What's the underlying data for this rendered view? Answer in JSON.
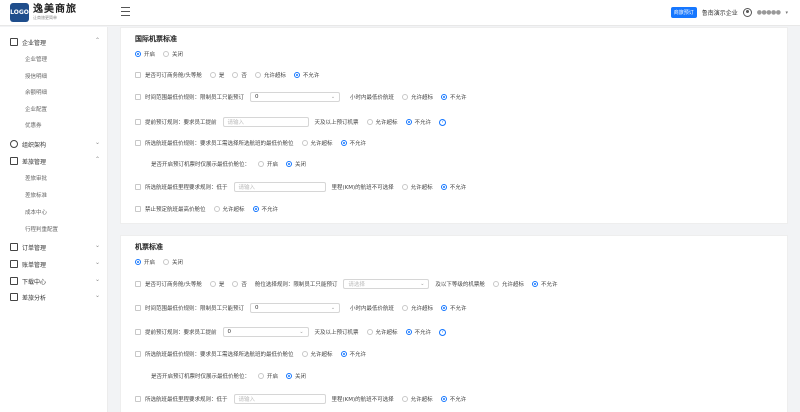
{
  "header": {
    "logo_mark": "LOGO",
    "logo_title": "逸美商旅",
    "logo_sub": "让商旅更简单",
    "badge": "商旅预订",
    "company": "鲁南演示企业",
    "username": "●●●●●"
  },
  "sidebar": {
    "groups": [
      {
        "label": "企业管理",
        "icon": "building-icon"
      },
      {
        "label": "组织架构",
        "icon": "org-icon"
      },
      {
        "label": "差旅管理",
        "icon": "briefcase-icon"
      },
      {
        "label": "订单管理",
        "icon": "order-icon"
      },
      {
        "label": "账单管理",
        "icon": "bill-icon"
      },
      {
        "label": "下载中心",
        "icon": "download-icon"
      },
      {
        "label": "差旅分析",
        "icon": "chart-icon"
      }
    ],
    "sub_enterprise": [
      "企业管理",
      "授信明细",
      "余额明细",
      "企业配置",
      "优惠券"
    ],
    "sub_travel": [
      "差旅审批",
      "差旅标准",
      "成本中心",
      "行程判重配置"
    ]
  },
  "card1": {
    "title": "国际机票标准",
    "enable": "开启",
    "disable": "关闭",
    "r1": "是否可订商务舱/头等舱",
    "yes": "是",
    "no": "否",
    "allow_over": "允许超标",
    "disallow": "不允许",
    "r2": "时间范围最低价规则：限制员工只能预订",
    "r2_value": "0",
    "r2_suffix": "小时内最低价航班",
    "r3": "提前预订规则：要求员工提前",
    "r3_placeholder": "请输入",
    "r3_suffix": "天及以上预订机票",
    "r4": "所选航班最低价规则：要求员工需选择所选航班的最低价舱位",
    "r5": "是否开启预订机票时仅展示最低价舱位：",
    "open": "开启",
    "close": "关闭",
    "r6": "所选航班最低里程要求规则：低于",
    "r6_placeholder": "请输入",
    "r6_suffix": "里程(KM)的航班不可选择",
    "r7": "禁止预定航班最高价舱位"
  },
  "card2": {
    "title": "机票标准",
    "enable": "开启",
    "disable": "关闭",
    "r1": "是否可订商务舱/头等舱",
    "yes": "是",
    "no": "否",
    "cabin_rule": "舱位选择规则：限制员工只能预订",
    "cabin_placeholder": "请选择",
    "cabin_suffix": "及以下等级的机票舱",
    "allow_over": "允许超标",
    "disallow": "不允许",
    "r2": "时间范围最低价规则：限制员工只能预订",
    "r2_value": "0",
    "r2_suffix": "小时内最低价航班",
    "r3": "提前预订规则：要求员工提前",
    "r3_value": "0",
    "r3_suffix": "天及以上预订机票",
    "r4": "所选航班最低价规则：要求员工需选择所选航班的最低价舱位",
    "r5": "是否开启预订机票时仅展示最低价舱位：",
    "open": "开启",
    "close": "关闭",
    "r6": "所选航班最低里程要求规则：低于",
    "r6_placeholder": "请输入",
    "r6_suffix": "里程(KM)的航班不可选择"
  }
}
